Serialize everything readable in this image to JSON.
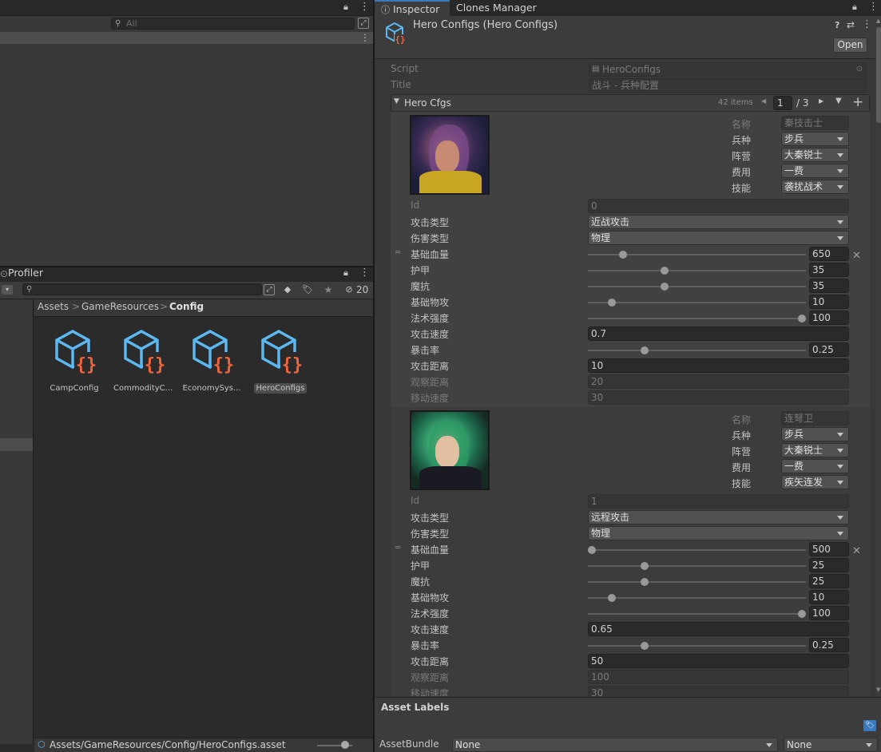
{
  "hierarchy": {
    "search_placeholder": "All"
  },
  "project": {
    "tab_label": "Profiler",
    "hidden_count": "20",
    "breadcrumb": [
      "Assets",
      "GameResources",
      "Config"
    ],
    "assets": [
      {
        "name": "CampConfig",
        "selected": false
      },
      {
        "name": "CommodityC...",
        "selected": false
      },
      {
        "name": "EconomySys...",
        "selected": false
      },
      {
        "name": "HeroConfigs",
        "selected": true
      }
    ],
    "status_path": "Assets/GameResources/Config/HeroConfigs.asset"
  },
  "inspector": {
    "tabs": [
      "Inspector",
      "Clones Manager"
    ],
    "title": "Hero Configs (Hero Configs)",
    "open_label": "Open",
    "script_label": "Script",
    "script_value": "HeroConfigs",
    "title_label": "Title",
    "title_value": "战斗 - 兵种配置",
    "list_label": "Hero Cfgs",
    "items_count": "42 items",
    "page": "1",
    "page_total": "/ 3",
    "asset_labels": "Asset Labels",
    "assetbundle_label": "AssetBundle",
    "assetbundle_value": "None",
    "assetbundle_variant": "None"
  },
  "heroes": [
    {
      "name_label": "名称",
      "name": "秦技击士",
      "type_label": "兵种",
      "type": "步兵",
      "camp_label": "阵营",
      "camp": "大秦锐士",
      "cost_label": "费用",
      "cost": "一费",
      "skill_label": "技能",
      "skill": "袭扰战术",
      "id_label": "Id",
      "id": "0",
      "atk_type_label": "攻击类型",
      "atk_type": "近战攻击",
      "dmg_type_label": "伤害类型",
      "dmg_type": "物理",
      "sliders": [
        {
          "label": "基础血量",
          "value": "650",
          "level": 0.16
        },
        {
          "label": "护甲",
          "value": "35",
          "level": 0.35
        },
        {
          "label": "魔抗",
          "value": "35",
          "level": 0.35
        },
        {
          "label": "基础物攻",
          "value": "10",
          "level": 0.11
        },
        {
          "label": "法术强度",
          "value": "100",
          "level": 0.98
        }
      ],
      "atk_speed_label": "攻击速度",
      "atk_speed": "0.7",
      "crit_label": "暴击率",
      "crit": "0.25",
      "crit_level": 0.26,
      "range_label": "攻击距离",
      "range": "10",
      "view_label": "观察距离",
      "view": "20",
      "move_label": "移动速度",
      "move": "30"
    },
    {
      "name_label": "名称",
      "name": "连弩卫",
      "type_label": "兵种",
      "type": "步兵",
      "camp_label": "阵营",
      "camp": "大秦锐士",
      "cost_label": "费用",
      "cost": "一费",
      "skill_label": "技能",
      "skill": "疾矢连发",
      "id_label": "Id",
      "id": "1",
      "atk_type_label": "攻击类型",
      "atk_type": "远程攻击",
      "dmg_type_label": "伤害类型",
      "dmg_type": "物理",
      "sliders": [
        {
          "label": "基础血量",
          "value": "500",
          "level": 0.02
        },
        {
          "label": "护甲",
          "value": "25",
          "level": 0.26
        },
        {
          "label": "魔抗",
          "value": "25",
          "level": 0.26
        },
        {
          "label": "基础物攻",
          "value": "10",
          "level": 0.11
        },
        {
          "label": "法术强度",
          "value": "100",
          "level": 0.98
        }
      ],
      "atk_speed_label": "攻击速度",
      "atk_speed": "0.65",
      "crit_label": "暴击率",
      "crit": "0.25",
      "crit_level": 0.26,
      "range_label": "攻击距离",
      "range": "50",
      "view_label": "观察距离",
      "view": "100",
      "move_label": "移动速度",
      "move": "30"
    }
  ],
  "colors": {
    "accent": "#3a79bb",
    "icon_blue": "#5cb8f0",
    "icon_orange": "#f0643c"
  }
}
